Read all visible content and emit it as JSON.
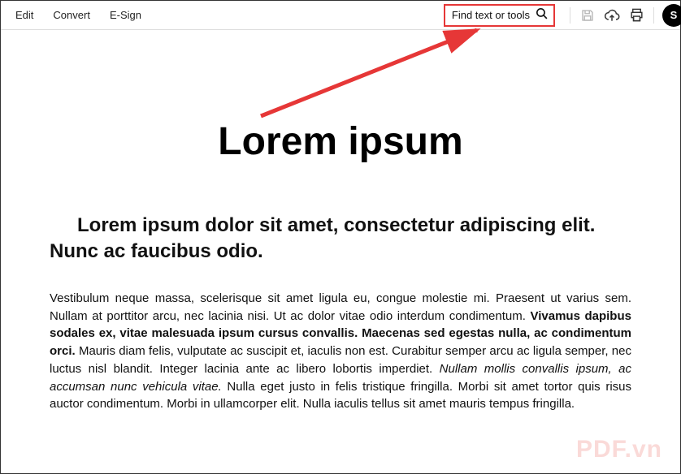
{
  "toolbar": {
    "menu": [
      "Edit",
      "Convert",
      "E-Sign"
    ],
    "search_placeholder": "Find text or tools",
    "avatar_initial": "S"
  },
  "document": {
    "title": "Lorem ipsum",
    "heading": "Lorem ipsum dolor sit amet, consectetur adipiscing elit. Nunc ac faucibus odio.",
    "para_parts": {
      "p1": "Vestibulum neque massa, scelerisque sit amet ligula eu, congue molestie mi. Praesent ut varius sem. Nullam at porttitor arcu, nec lacinia nisi. Ut ac dolor vitae odio interdum condimentum. ",
      "p2_bold": "Vivamus dapibus sodales ex, vitae malesuada ipsum cursus convallis. Maecenas sed egestas nulla, ac condimentum orci.",
      "p3": " Mauris diam felis, vulputate ac suscipit et, iaculis non est. Curabitur semper arcu ac ligula semper, nec luctus nisl blandit. Integer lacinia ante ac libero lobortis imperdiet. ",
      "p4_italic": "Nullam mollis convallis ipsum, ac accumsan nunc vehicula vitae.",
      "p5": " Nulla eget justo in felis tristique fringilla. Morbi sit amet tortor quis risus auctor condimentum. Morbi in ullamcorper elit. Nulla iaculis tellus sit amet mauris tempus fringilla."
    }
  },
  "watermark": "PDF.vn",
  "annotation_color": "#e63737"
}
